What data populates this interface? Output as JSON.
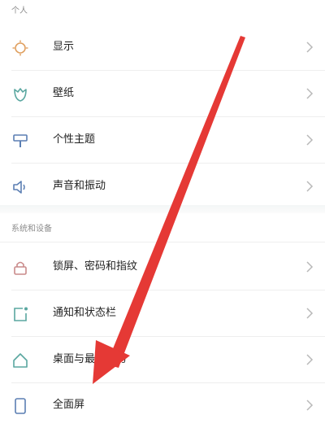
{
  "sections": [
    {
      "title": "个人",
      "items": [
        {
          "label": "显示",
          "icon": "sun-icon"
        },
        {
          "label": "壁纸",
          "icon": "wallpaper-icon"
        },
        {
          "label": "个性主题",
          "icon": "theme-brush-icon"
        },
        {
          "label": "声音和振动",
          "icon": "speaker-icon"
        }
      ]
    },
    {
      "title": "系统和设备",
      "items": [
        {
          "label": "锁屏、密码和指纹",
          "icon": "lock-icon"
        },
        {
          "label": "通知和状态栏",
          "icon": "notification-icon"
        },
        {
          "label": "桌面与最近任务",
          "icon": "home-icon"
        },
        {
          "label": "全面屏",
          "icon": "phone-icon"
        }
      ]
    }
  ],
  "colors": {
    "icon_orange": "#e0a060",
    "icon_teal": "#5aa7a0",
    "icon_pink": "#c98a8a",
    "icon_blue": "#5b7fb3",
    "arrow": "#e53935"
  }
}
